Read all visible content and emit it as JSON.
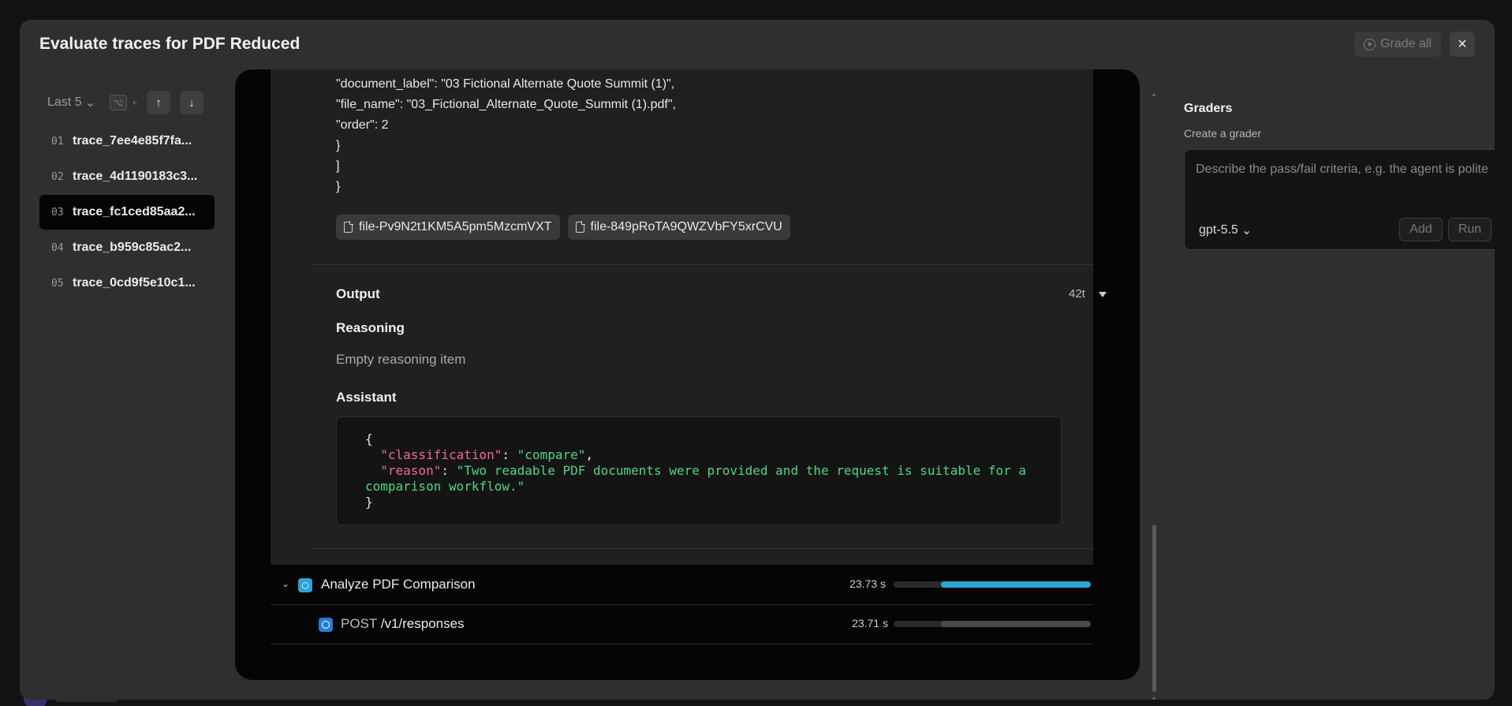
{
  "modal": {
    "title": "Evaluate traces for PDF Reduced",
    "grade_all_label": "Grade all",
    "close_icon": "×"
  },
  "sidebar": {
    "filter_label": "Last 5",
    "shortcut_key": "⌥",
    "shortcut_plus": "+",
    "traces": [
      {
        "num": "01",
        "name": "trace_7ee4e85f7fa..."
      },
      {
        "num": "02",
        "name": "trace_4d1190183c3..."
      },
      {
        "num": "03",
        "name": "trace_fc1ced85aa2...",
        "selected": true
      },
      {
        "num": "04",
        "name": "trace_b959c85ac2..."
      },
      {
        "num": "05",
        "name": "trace_0cd9f5e10c1..."
      }
    ]
  },
  "input_json": {
    "lines": [
      "\"document_label\": \"03 Fictional Alternate Quote Summit (1)\",",
      "\"file_name\": \"03_Fictional_Alternate_Quote_Summit (1).pdf\",",
      "\"order\": 2",
      "}",
      "]",
      "}"
    ]
  },
  "files": [
    "file-Pv9N2t1KM5A5pm5MzcmVXT",
    "file-849pRoTA9QWZVbFY5xrCVU"
  ],
  "output": {
    "title": "Output",
    "token_count": "42t",
    "reasoning_title": "Reasoning",
    "reasoning_text": "Empty reasoning item",
    "assistant_title": "Assistant",
    "code": {
      "open": "{",
      "k1": "\"classification\"",
      "v1": "\"compare\"",
      "k2": "\"reason\"",
      "v2a": "\"Two readable PDF documents were provided and the request is suitable for a",
      "v2b": "comparison workflow.\"",
      "close": "}"
    }
  },
  "spans": [
    {
      "label": "Analyze PDF Comparison",
      "method": "",
      "duration": "23.73 s",
      "bar_start": 0.24,
      "bar_fraction": 0.76,
      "icon": "cube-icon"
    },
    {
      "label": "/v1/responses",
      "method": "POST",
      "duration": "23.71 s",
      "bar_start": 0.24,
      "bar_fraction": 0.76,
      "icon": "openai-icon"
    }
  ],
  "graders": {
    "title": "Graders",
    "subtitle": "Create a grader",
    "placeholder": "Describe the pass/fail criteria, e.g. the agent is polite",
    "model": "gpt-5.5",
    "add_label": "Add",
    "run_label": "Run"
  }
}
